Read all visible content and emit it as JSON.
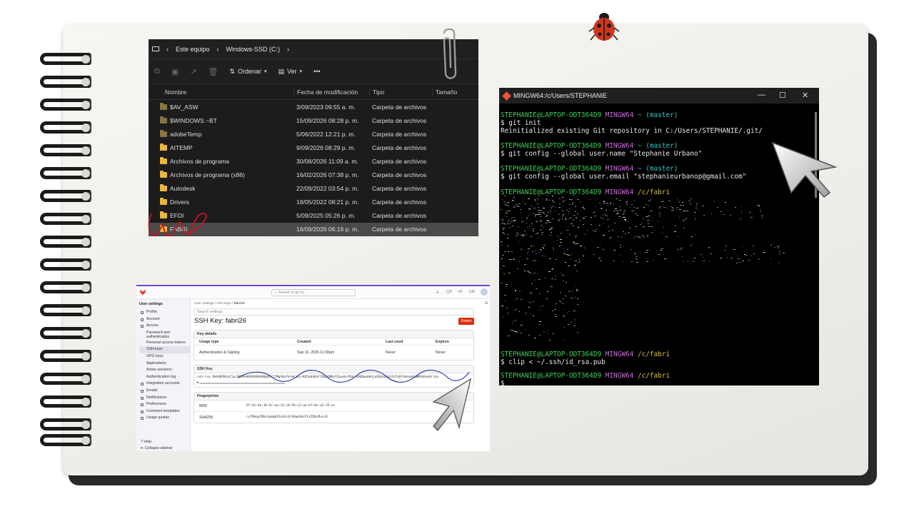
{
  "explorer": {
    "breadcrumb": [
      "Este equipo",
      "Windows-SSD (C:)"
    ],
    "toolbar": {
      "sort_label": "Ordenar",
      "view_label": "Ver",
      "more_label": "•••"
    },
    "columns": [
      "Nombre",
      "Fecha de modificación",
      "Tipo",
      "Tamaño"
    ],
    "rows": [
      {
        "name": "$AV_ASW",
        "date": "3/09/2023 09:55 a. m.",
        "type": "Carpeta de archivos"
      },
      {
        "name": "$WINDOWS.~BT",
        "date": "15/09/2026 08:28 p. m.",
        "type": "Carpeta de archivos"
      },
      {
        "name": "adobeTemp",
        "date": "5/06/2022 12:21 p. m.",
        "type": "Carpeta de archivos"
      },
      {
        "name": "AITEMP",
        "date": "9/09/2026 08:29 p. m.",
        "type": "Carpeta de archivos"
      },
      {
        "name": "Archivos de programa",
        "date": "30/08/2026 11:09 a. m.",
        "type": "Carpeta de archivos"
      },
      {
        "name": "Archivos de programa (x86)",
        "date": "16/02/2026 07:38 p. m.",
        "type": "Carpeta de archivos"
      },
      {
        "name": "Autodesk",
        "date": "22/09/2022 03:54 p. m.",
        "type": "Carpeta de archivos"
      },
      {
        "name": "Drivers",
        "date": "18/05/2022 08:21 p. m.",
        "type": "Carpeta de archivos"
      },
      {
        "name": "EFDI",
        "date": "5/09/2025 05:26 p. m.",
        "type": "Carpeta de archivos"
      },
      {
        "name": "FABRI",
        "date": "16/09/2026 06:16 p. m.",
        "type": "Carpeta de archivos"
      }
    ]
  },
  "terminal": {
    "title": "MINGW64:/c/Users/STEPHANIE",
    "prompt_user": "STEPHANIE@LAPTOP-ODT364D9",
    "prompt_env": "MINGW64",
    "lines": [
      {
        "path": "~ (master)",
        "cmd": "$ git init",
        "out": "Reinitialized existing Git repository in C:/Users/STEPHANIE/.git/"
      },
      {
        "path": "~ (master)",
        "cmd": "$ git config --global user.name \"Stephanie Urbano\""
      },
      {
        "path": "~ (master)",
        "cmd": "$ git config --global user.email \"stephanieurbanop@gmail.com\""
      },
      {
        "path": "/c/fabri"
      },
      {
        "path": "/c/fabri",
        "cmd": "$ clip < ~/.ssh/id_rsa.pub"
      },
      {
        "path": "/c/fabri",
        "cmd": "$"
      }
    ]
  },
  "gitlab": {
    "search_placeholder": "Search or go to...",
    "sidebar_title": "User settings",
    "sidebar": [
      {
        "label": "Profile"
      },
      {
        "label": "Account"
      },
      {
        "label": "Access"
      },
      {
        "label": "Password and authentication",
        "sub": true
      },
      {
        "label": "Personal access tokens",
        "sub": true
      },
      {
        "label": "SSH keys",
        "sub": true,
        "active": true
      },
      {
        "label": "GPG keys",
        "sub": true
      },
      {
        "label": "Applications",
        "sub": true
      },
      {
        "label": "Active sessions",
        "sub": true
      },
      {
        "label": "Authentication log",
        "sub": true
      },
      {
        "label": "Integration accounts"
      },
      {
        "label": "Emails"
      },
      {
        "label": "Notifications"
      },
      {
        "label": "Preferences"
      },
      {
        "label": "Comment templates"
      },
      {
        "label": "Usage quotas"
      }
    ],
    "help": "Help",
    "collapse": "Collapse sidebar",
    "breadcrumb": [
      "User Settings",
      "SSH keys",
      "fabri26"
    ],
    "search_settings": "Search settings",
    "page_title": "SSH Key: fabri26",
    "delete_label": "Delete",
    "key_details": {
      "header": "Key details",
      "columns": [
        "Usage type",
        "Created",
        "Last used",
        "Expires"
      ],
      "values": [
        "Authentication & Signing",
        "Sep 16, 2026 11:30pm",
        "Never",
        "Never"
      ]
    },
    "ssh_key": {
      "header": "SSH Key",
      "value": "ssh-rsa AAAAB3NzaC1yc2EAAAADAQABAAABgQCr7JMgh8xYk+Ws1xL+KQ5edd6nFlD0aDBKwYZpyebrPUeJoUQ8peHbdjaSQoXahGCA1YqSY4deo6deWB9d4ek6rJyv"
    },
    "fingerprints": {
      "header": "Fingerprints",
      "rows": [
        {
          "label": "MD5",
          "value": "6f:d1:4a:3b:6c:aa:15:c8:5b:c3:ae:bf:0c:a2:35:ec"
        },
        {
          "label": "SHA256",
          "value": "ryTMkqa7Rbshp0g0YEuShr0/AHqoSH/FCsZQ6cMvx/8"
        }
      ]
    },
    "topbar_counts": [
      "0",
      "0",
      "0"
    ]
  }
}
